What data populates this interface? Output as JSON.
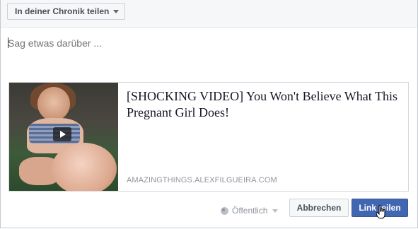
{
  "header": {
    "share_target_label": "In deiner Chronik teilen",
    "share_target_icon": "chevron-down-icon"
  },
  "composer": {
    "placeholder": "Sag etwas darüber ..."
  },
  "link_preview": {
    "title": "[SHOCKING VIDEO] You Won't Believe What This Pregnant Girl Does!",
    "domain": "AMAZINGTHINGS.ALEXFILGUEIRA.COM",
    "thumbnail_icon": "play-icon"
  },
  "footer": {
    "privacy_label": "Öffentlich",
    "privacy_icon": "globe-icon",
    "cancel_label": "Abbrechen",
    "share_label": "Link teilen"
  },
  "colors": {
    "primary": "#4267b2",
    "header_bg": "#f6f7f9",
    "muted_text": "#90949c"
  }
}
